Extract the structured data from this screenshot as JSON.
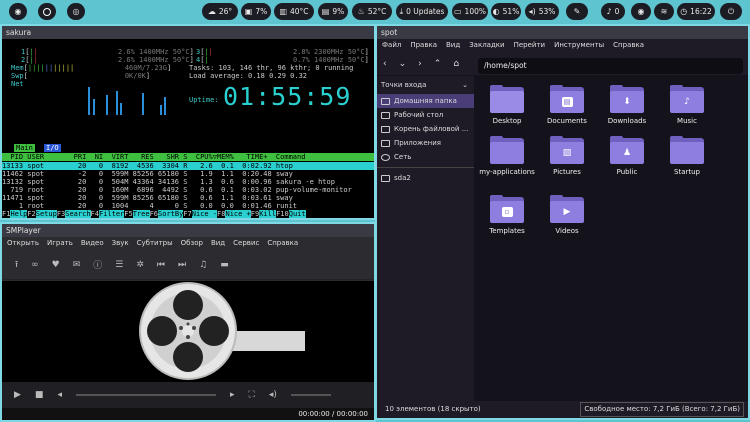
{
  "topbar": {
    "weather": "26°",
    "cpu": "7%",
    "gpu_temp": "40°C",
    "mem": "9%",
    "cpu_temp": "52°C",
    "updates": "0 Updates",
    "battery": "100%",
    "brightness": "51%",
    "volume": "53%",
    "notifications": "0",
    "clock": "16:22"
  },
  "sakura": {
    "title": "sakura",
    "cpu1": "2.6% 1400MHz 50°C",
    "cpu2": "2.6% 1400MHz 50°C",
    "cpu3": "2.8% 2300MHz 50°C",
    "cpu4": "0.7% 1400MHz 50°C",
    "mem": "460M/7.23G",
    "swp": "0K/0K",
    "tasks": "Tasks: 103, 146 thr, 96 kthr; 0 running",
    "load": "Load average: 0.18 0.29 0.32",
    "uptime_label": "Uptime:",
    "uptime": "01:55:59",
    "tab_main": "Main",
    "tab_io": "I/O",
    "header": "  PID USER       PRI  NI  VIRT   RES   SHR S  CPU%▽MEM%   TIME+  Command",
    "rows": [
      "13133 spot        20   0  8192  4536  3304 R   2.6  0.1  0:02.92 htop",
      "11462 spot        -2   0  599M 85256 65180 S   1.9  1.1  0:20.48 sway",
      "13132 spot        20   0  504M 43364 34136 S   1.3  0.6  0:00.96 sakura -e htop",
      "  719 root        20   0  160M  6896  4492 S   0.6  0.1  0:03.02 pup-volume-monitor",
      "11471 spot        20   0  599M 85256 65180 S   0.6  1.1  0:03.61 sway",
      "    1 root        20   0  1004     4     0 S   0.0  0.0  0:01.46 runit"
    ],
    "fkeys": [
      "Help",
      "Setup",
      "Search",
      "Filter",
      "Tree",
      "SortBy",
      "Nice -",
      "Nice +",
      "Kill",
      "Quit"
    ]
  },
  "smplayer": {
    "title": "SMPlayer",
    "menu": [
      "Открыть",
      "Играть",
      "Видео",
      "Звук",
      "Субтитры",
      "Обзор",
      "Вид",
      "Сервис",
      "Справка"
    ],
    "time": "00:00:00 / 00:00:00"
  },
  "fm": {
    "title": "spot",
    "menu": [
      "Файл",
      "Правка",
      "Вид",
      "Закладки",
      "Перейти",
      "Инструменты",
      "Справка"
    ],
    "path": "/home/spot",
    "side_header": "Точки входа",
    "side_items": [
      "Домашняя папка",
      "Рабочий стол",
      "Корень файловой ...",
      "Приложения",
      "Сеть",
      "sda2"
    ],
    "items": [
      "Desktop",
      "Documents",
      "Downloads",
      "Music",
      "my-applications",
      "Pictures",
      "Public",
      "Startup",
      "Templates",
      "Videos"
    ],
    "status_left": "10 элементов (18 скрыто)",
    "status_right": "Свободное место: 7,2 ГиБ (Всего: 7,2 ГиБ)"
  },
  "colors": {
    "accent": "#5ec4cf",
    "folder": "#8e7ee0",
    "selection": "#4a3d78"
  }
}
